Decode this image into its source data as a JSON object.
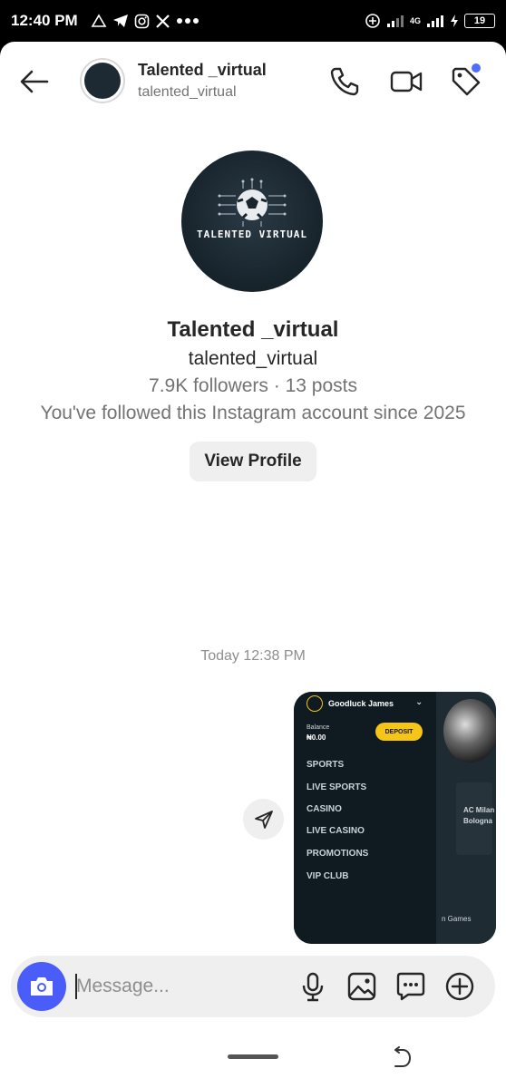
{
  "status_bar": {
    "time": "12:40 PM",
    "network_label": "4G",
    "battery": "19"
  },
  "header": {
    "name": "Talented _virtual",
    "username": "talented_virtual",
    "icons": [
      "back-arrow-icon",
      "phone-icon",
      "video-icon",
      "tag-icon"
    ]
  },
  "profile": {
    "logo_text": "TALENTED VIRTUAL",
    "name": "Talented _virtual",
    "username": "talented_virtual",
    "stats": "7.9K followers · 13 posts",
    "follow_note": "You've followed this Instagram account since 2025",
    "view_profile_label": "View Profile"
  },
  "thread": {
    "timestamp": "Today 12:38 PM"
  },
  "shared_screenshot": {
    "user": "Goodluck James",
    "balance_label": "Balance",
    "balance_value": "₦0.00",
    "deposit_label": "DEPOSIT",
    "menu": [
      "SPORTS",
      "LIVE SPORTS",
      "CASINO",
      "LIVE CASINO",
      "PROMOTIONS",
      "VIP CLUB"
    ],
    "side_text_1": "AC Milan",
    "side_text_2": "Bologna",
    "side_text_3": "n Games"
  },
  "composer": {
    "placeholder": "Message..."
  },
  "colors": {
    "accent": "#4a5df9",
    "deposit": "#f5c518",
    "notification_dot": "#4f6df5"
  }
}
